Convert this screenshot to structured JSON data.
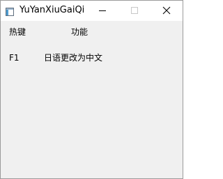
{
  "window": {
    "title": "YuYanXiuGaiQi",
    "icon": "app-window-icon",
    "controls": {
      "minimize_icon": "minimize-icon",
      "maximize_icon": "maximize-icon",
      "close_icon": "close-icon"
    }
  },
  "hotkey_table": {
    "headers": {
      "hotkey": "热键",
      "function": "功能"
    },
    "rows": [
      {
        "key": "F1",
        "function": "日语更改为中文"
      }
    ]
  },
  "colors": {
    "titlebar_bg": "#ffffff",
    "content_bg": "#f0f0f0",
    "window_border": "#9b9b9b",
    "text": "#000000"
  }
}
